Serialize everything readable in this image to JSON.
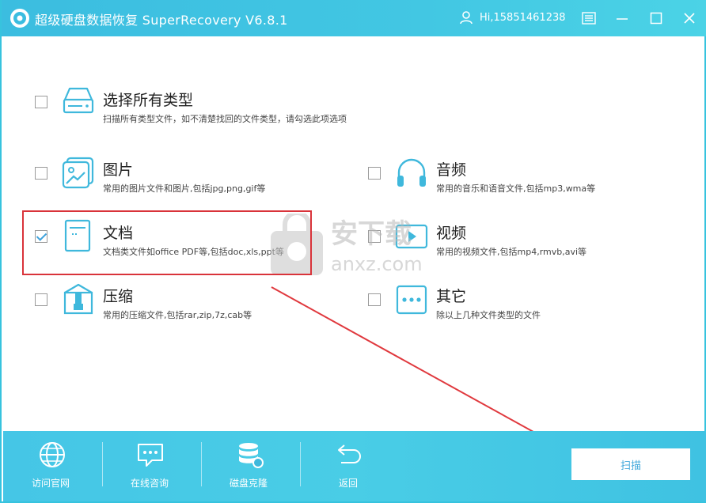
{
  "app": {
    "title": "超级硬盘数据恢复 SuperRecovery V6.8.1",
    "user": "Hi,15851461238"
  },
  "types": {
    "all": {
      "label": "选择所有类型",
      "desc": "扫描所有类型文件，如不清楚找回的文件类型，请勾选此项选项",
      "checked": false
    },
    "pictures": {
      "label": "图片",
      "desc": "常用的图片文件和图片,包括jpg,png,gif等",
      "checked": false
    },
    "audio": {
      "label": "音频",
      "desc": "常用的音乐和语音文件,包括mp3,wma等",
      "checked": false
    },
    "documents": {
      "label": "文档",
      "desc": "文档类文件如office PDF等,包括doc,xls,ppt等",
      "checked": true
    },
    "video": {
      "label": "视频",
      "desc": "常用的视频文件,包括mp4,rmvb,avi等",
      "checked": false
    },
    "archives": {
      "label": "压缩",
      "desc": "常用的压缩文件,包括rar,zip,7z,cab等",
      "checked": false
    },
    "other": {
      "label": "其它",
      "desc": "除以上几种文件类型的文件",
      "checked": false
    }
  },
  "watermark": {
    "brand": "安下载",
    "domain": "anxz.com"
  },
  "bottom": {
    "website": "访问官网",
    "consult": "在线咨询",
    "clone": "磁盘克隆",
    "back": "返回",
    "scan": "扫描"
  },
  "colors": {
    "accent": "#42c7e3",
    "highlight": "#d9333a",
    "icon": "#3fb8dc"
  }
}
